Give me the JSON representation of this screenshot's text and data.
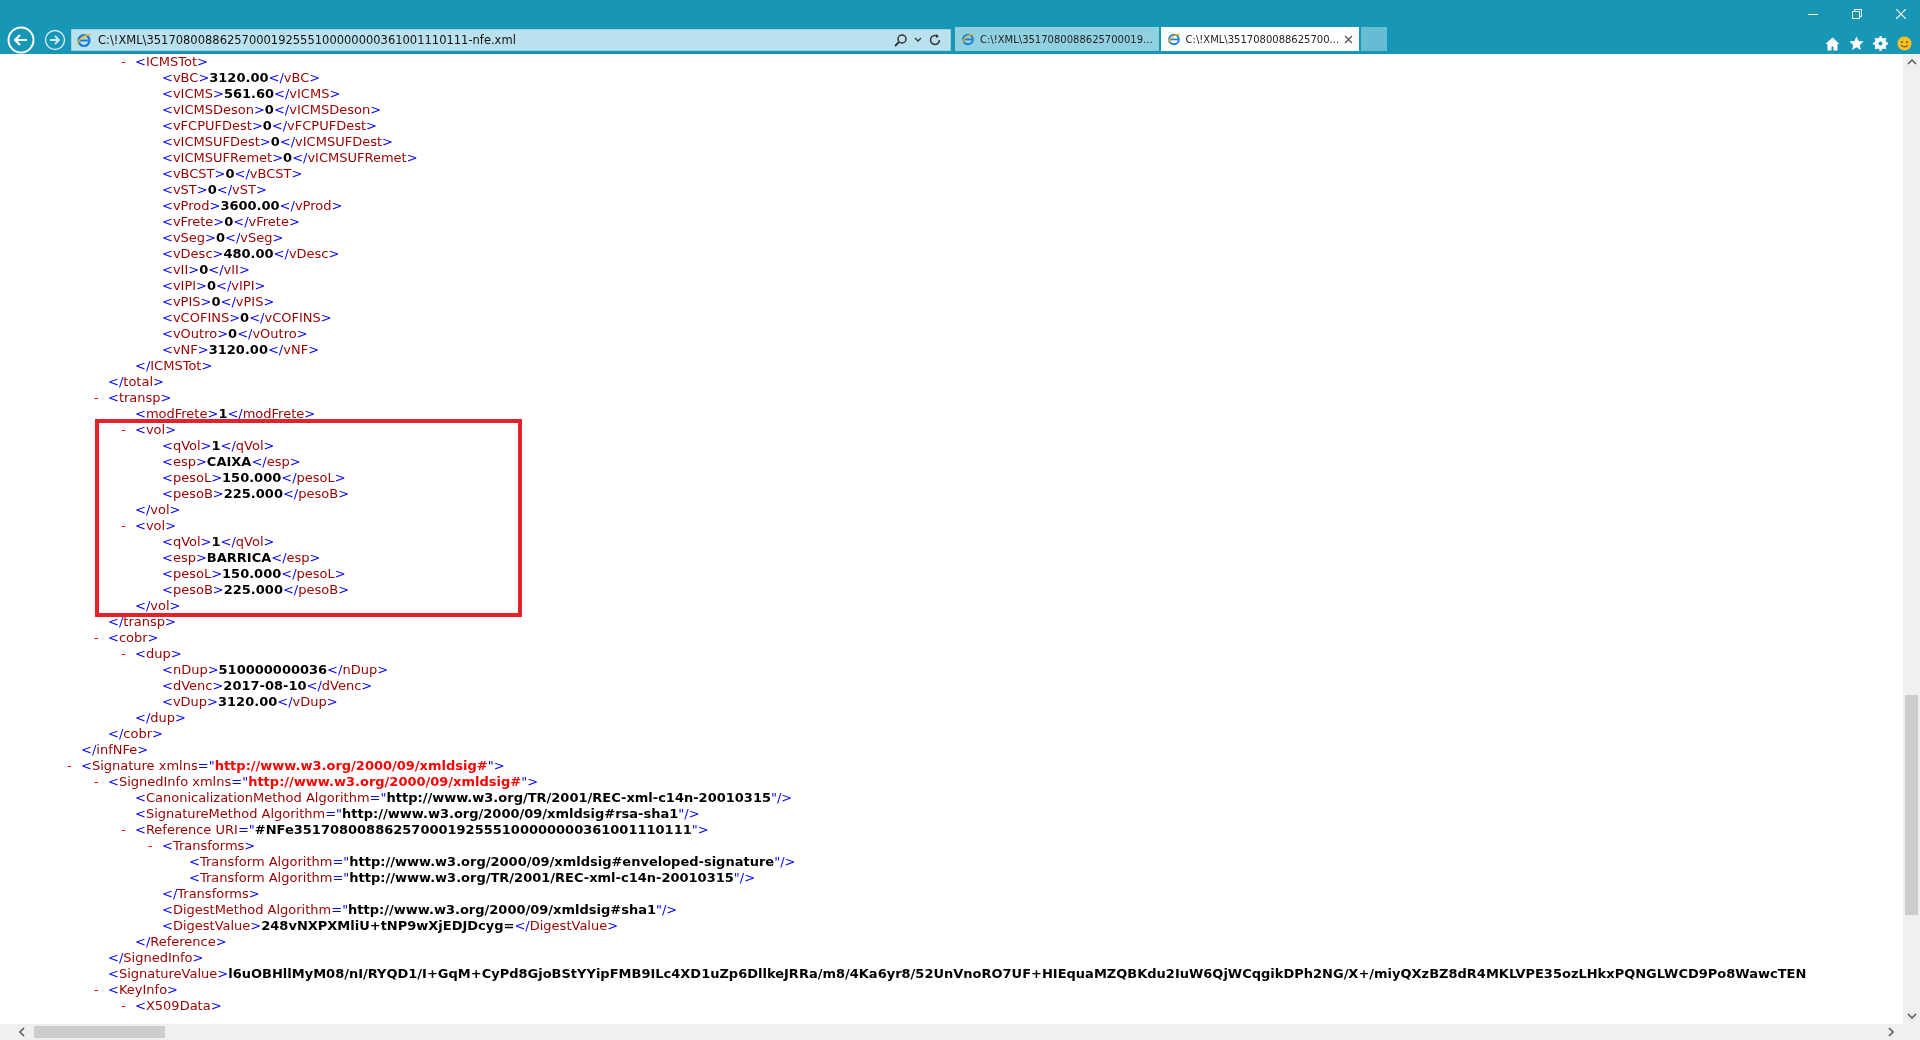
{
  "browser": {
    "address": "C:\\!XML\\35170800886257000192555100000000361001110111-nfe.xml",
    "tabs": [
      {
        "title": "C:\\!XML\\3517080088625700019...",
        "selected": false
      },
      {
        "title": "C:\\!XML\\3517080088625700...",
        "selected": true
      }
    ]
  },
  "document": [
    {
      "kind": "tail",
      "close": "</infNFe>",
      "children": [
        {
          "kind": "tail",
          "close": "</total>",
          "children": [
            {
              "kind": "element",
              "toggle": "-",
              "open": "<ICMSTot>",
              "close": "</ICMSTot>",
              "children": [
                {
                  "kind": "leaf",
                  "open": "<vBC>",
                  "value": "3120.00",
                  "close": "</vBC>"
                },
                {
                  "kind": "leaf",
                  "open": "<vICMS>",
                  "value": "561.60",
                  "close": "</vICMS>"
                },
                {
                  "kind": "leaf",
                  "open": "<vICMSDeson>",
                  "value": "0",
                  "close": "</vICMSDeson>"
                },
                {
                  "kind": "leaf",
                  "open": "<vFCPUFDest>",
                  "value": "0",
                  "close": "</vFCPUFDest>"
                },
                {
                  "kind": "leaf",
                  "open": "<vICMSUFDest>",
                  "value": "0",
                  "close": "</vICMSUFDest>"
                },
                {
                  "kind": "leaf",
                  "open": "<vICMSUFRemet>",
                  "value": "0",
                  "close": "</vICMSUFRemet>"
                },
                {
                  "kind": "leaf",
                  "open": "<vBCST>",
                  "value": "0",
                  "close": "</vBCST>"
                },
                {
                  "kind": "leaf",
                  "open": "<vST>",
                  "value": "0",
                  "close": "</vST>"
                },
                {
                  "kind": "leaf",
                  "open": "<vProd>",
                  "value": "3600.00",
                  "close": "</vProd>"
                },
                {
                  "kind": "leaf",
                  "open": "<vFrete>",
                  "value": "0",
                  "close": "</vFrete>"
                },
                {
                  "kind": "leaf",
                  "open": "<vSeg>",
                  "value": "0",
                  "close": "</vSeg>"
                },
                {
                  "kind": "leaf",
                  "open": "<vDesc>",
                  "value": "480.00",
                  "close": "</vDesc>"
                },
                {
                  "kind": "leaf",
                  "open": "<vII>",
                  "value": "0",
                  "close": "</vII>"
                },
                {
                  "kind": "leaf",
                  "open": "<vIPI>",
                  "value": "0",
                  "close": "</vIPI>"
                },
                {
                  "kind": "leaf",
                  "open": "<vPIS>",
                  "value": "0",
                  "close": "</vPIS>"
                },
                {
                  "kind": "leaf",
                  "open": "<vCOFINS>",
                  "value": "0",
                  "close": "</vCOFINS>"
                },
                {
                  "kind": "leaf",
                  "open": "<vOutro>",
                  "value": "0",
                  "close": "</vOutro>"
                },
                {
                  "kind": "leaf",
                  "open": "<vNF>",
                  "value": "3120.00",
                  "close": "</vNF>"
                }
              ]
            }
          ]
        },
        {
          "kind": "element",
          "toggle": "-",
          "open": "<transp>",
          "close": "</transp>",
          "children": [
            {
              "kind": "leaf",
              "open": "<modFrete>",
              "value": "1",
              "close": "</modFrete>"
            },
            {
              "kind": "element",
              "toggle": "-",
              "highlighted": true,
              "open": "<vol>",
              "close": "</vol>",
              "children": [
                {
                  "kind": "leaf",
                  "open": "<qVol>",
                  "value": "1",
                  "close": "</qVol>"
                },
                {
                  "kind": "leaf",
                  "open": "<esp>",
                  "value": "CAIXA",
                  "close": "</esp>"
                },
                {
                  "kind": "leaf",
                  "open": "<pesoL>",
                  "value": "150.000",
                  "close": "</pesoL>"
                },
                {
                  "kind": "leaf",
                  "open": "<pesoB>",
                  "value": "225.000",
                  "close": "</pesoB>"
                }
              ]
            },
            {
              "kind": "element",
              "toggle": "-",
              "highlighted": true,
              "open": "<vol>",
              "close": "</vol>",
              "children": [
                {
                  "kind": "leaf",
                  "open": "<qVol>",
                  "value": "1",
                  "close": "</qVol>"
                },
                {
                  "kind": "leaf",
                  "open": "<esp>",
                  "value": "BARRICA",
                  "close": "</esp>"
                },
                {
                  "kind": "leaf",
                  "open": "<pesoL>",
                  "value": "150.000",
                  "close": "</pesoL>"
                },
                {
                  "kind": "leaf",
                  "open": "<pesoB>",
                  "value": "225.000",
                  "close": "</pesoB>"
                }
              ]
            }
          ]
        },
        {
          "kind": "element",
          "toggle": "-",
          "open": "<cobr>",
          "close": "</cobr>",
          "children": [
            {
              "kind": "element",
              "toggle": "-",
              "open": "<dup>",
              "close": "</dup>",
              "children": [
                {
                  "kind": "leaf",
                  "open": "<nDup>",
                  "value": "510000000036",
                  "close": "</nDup>"
                },
                {
                  "kind": "leaf",
                  "open": "<dVenc>",
                  "value": "2017-08-10",
                  "close": "</dVenc>"
                },
                {
                  "kind": "leaf",
                  "open": "<vDup>",
                  "value": "3120.00",
                  "close": "</vDup>"
                }
              ]
            }
          ]
        }
      ]
    },
    {
      "kind": "head",
      "toggle": "-",
      "open": "<Signature",
      "attrs": [
        {
          "name": "xmlns=",
          "value": "\"http://www.w3.org/2000/09/xmldsig#\"",
          "kind": "namespace"
        }
      ],
      "open_end": ">",
      "children": [
        {
          "kind": "element",
          "toggle": "-",
          "open": "<SignedInfo",
          "attrs": [
            {
              "name": "xmlns=",
              "value": "\"http://www.w3.org/2000/09/xmldsig#\"",
              "kind": "namespace"
            }
          ],
          "open_end": ">",
          "close": "</SignedInfo>",
          "children": [
            {
              "kind": "empty",
              "open": "<CanonicalizationMethod",
              "attrs": [
                {
                  "name": "Algorithm=",
                  "value": "\"http://www.w3.org/TR/2001/REC-xml-c14n-20010315\"",
                  "kind": "plain"
                }
              ],
              "close": "/>"
            },
            {
              "kind": "empty",
              "open": "<SignatureMethod",
              "attrs": [
                {
                  "name": "Algorithm=",
                  "value": "\"http://www.w3.org/2000/09/xmldsig#rsa-sha1\"",
                  "kind": "plain"
                }
              ],
              "close": "/>"
            },
            {
              "kind": "element",
              "toggle": "-",
              "open": "<Reference",
              "attrs": [
                {
                  "name": "URI=",
                  "value": "\"#NFe35170800886257000192555100000000361001110111\"",
                  "kind": "plain"
                }
              ],
              "open_end": ">",
              "close": "</Reference>",
              "children": [
                {
                  "kind": "element",
                  "toggle": "-",
                  "open": "<Transforms>",
                  "close": "</Transforms>",
                  "children": [
                    {
                      "kind": "empty",
                      "open": "<Transform",
                      "attrs": [
                        {
                          "name": "Algorithm=",
                          "value": "\"http://www.w3.org/2000/09/xmldsig#enveloped-signature\"",
                          "kind": "plain"
                        }
                      ],
                      "close": "/>"
                    },
                    {
                      "kind": "empty",
                      "open": "<Transform",
                      "attrs": [
                        {
                          "name": "Algorithm=",
                          "value": "\"http://www.w3.org/TR/2001/REC-xml-c14n-20010315\"",
                          "kind": "plain"
                        }
                      ],
                      "close": "/>"
                    }
                  ]
                },
                {
                  "kind": "empty",
                  "open": "<DigestMethod",
                  "attrs": [
                    {
                      "name": "Algorithm=",
                      "value": "\"http://www.w3.org/2000/09/xmldsig#sha1\"",
                      "kind": "plain"
                    }
                  ],
                  "close": "/>"
                },
                {
                  "kind": "leaf",
                  "open": "<DigestValue>",
                  "value": "248vNXPXMliU+tNP9wXjEDJDcyg=",
                  "close": "</DigestValue>"
                }
              ]
            }
          ]
        },
        {
          "kind": "leaf",
          "open": "<SignatureValue>",
          "value": "l6uOBHllMyM08/nI/RYQD1/I+GqM+CyPd8GjoBStYYipFMB9ILc4XD1uZp6DllkeJRRa/m8/4Ka6yr8/52UnVnoRO7UF+HIEquaMZQBKdu2IuW6QjWCqgikDPh2NG/X+/miyQXzBZ8dR4MKLVPE35ozLHkxPQNGLWCD9Po8WawcTEN"
        },
        {
          "kind": "head",
          "toggle": "-",
          "open": "<KeyInfo>",
          "children": [
            {
              "kind": "head",
              "toggle": "-",
              "open": "<X509Data>"
            }
          ]
        }
      ]
    }
  ]
}
